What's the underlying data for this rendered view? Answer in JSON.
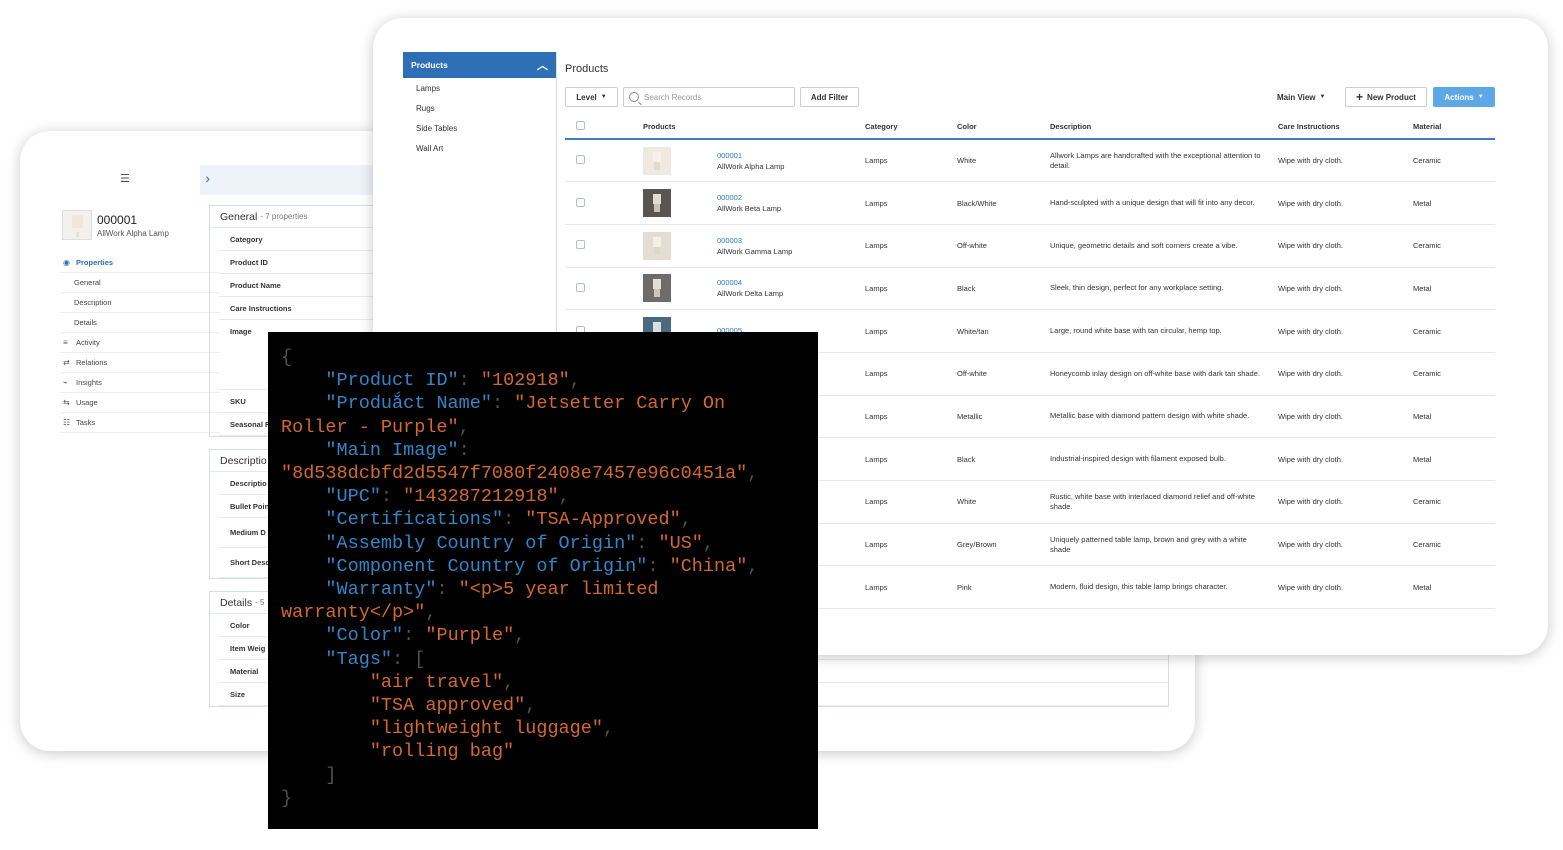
{
  "detail_window": {
    "product_id": "000001",
    "product_name": "AllWork Alpha Lamp",
    "nav": [
      {
        "label": "Properties",
        "icon": "properties-icon",
        "active": true
      },
      {
        "label": "General",
        "sub": true
      },
      {
        "label": "Description",
        "sub": true
      },
      {
        "label": "Details",
        "sub": true
      },
      {
        "label": "Activity",
        "icon": "activity-icon"
      },
      {
        "label": "Relations",
        "icon": "relations-icon"
      },
      {
        "label": "Insights",
        "icon": "insights-icon"
      },
      {
        "label": "Usage",
        "icon": "usage-icon"
      },
      {
        "label": "Tasks",
        "icon": "tasks-icon"
      }
    ],
    "sections": {
      "general": {
        "title": "General",
        "count": "- 7 properties",
        "fields": [
          "Category",
          "Product ID",
          "Product Name",
          "Care Instructions",
          "Image",
          "SKU",
          "Seasonal F"
        ]
      },
      "description": {
        "title": "Descriptio",
        "fields": [
          "Descriptio",
          "Bullet Poin",
          "Medium D",
          "Short Desc"
        ]
      },
      "details": {
        "title": "Details",
        "count": "- 5",
        "fields": [
          "Color",
          "Item Weig",
          "Material",
          "Size"
        ]
      }
    }
  },
  "products_window": {
    "sidebar": {
      "header": "Products",
      "items": [
        "Lamps",
        "Rugs",
        "Side Tables",
        "Wall Art"
      ]
    },
    "title": "Products",
    "toolbar": {
      "level_label": "Level",
      "search_placeholder": "Search Records",
      "add_filter_label": "Add Filter",
      "main_view_label": "Main View",
      "new_product_label": "New Product",
      "actions_label": "Actions"
    },
    "columns": [
      "Products",
      "Category",
      "Color",
      "Description",
      "Care Instructions",
      "Material"
    ],
    "rows": [
      {
        "id": "000001",
        "name": "AllWork Alpha Lamp",
        "category": "Lamps",
        "color": "White",
        "description": "Allwork Lamps are handcrafted with the exceptional attention to detail.",
        "care": "Wipe with dry cloth.",
        "material": "Ceramic",
        "thumb": "#efe9e1"
      },
      {
        "id": "000002",
        "name": "AllWork Beta Lamp",
        "category": "Lamps",
        "color": "Black/White",
        "description": "Hand-sculpted with a unique design that will fit into any decor.",
        "care": "Wipe with dry cloth.",
        "material": "Metal",
        "thumb": "#5a5550"
      },
      {
        "id": "000003",
        "name": "AllWork Gamma Lamp",
        "category": "Lamps",
        "color": "Off-white",
        "description": "Unique, geometric details and soft corners create a vibe.",
        "care": "Wipe with dry cloth.",
        "material": "Ceramic",
        "thumb": "#e4ddd3"
      },
      {
        "id": "000004",
        "name": "AllWork Delta Lamp",
        "category": "Lamps",
        "color": "Black",
        "description": "Sleek, thin design, perfect for any workplace setting.",
        "care": "Wipe with dry cloth.",
        "material": "Metal",
        "thumb": "#6e6b68"
      },
      {
        "id": "000005",
        "name": "",
        "category": "Lamps",
        "color": "White/tan",
        "description": "Large, round white base with tan circular, hemp top.",
        "care": "Wipe with dry cloth.",
        "material": "Ceramic",
        "thumb": "#4a6a80"
      },
      {
        "id": "",
        "name": "",
        "category": "Lamps",
        "color": "Off-white",
        "description": "Honeycomb inlay design on off-white base with dark tan shade.",
        "care": "Wipe with dry cloth.",
        "material": "Ceramic",
        "thumb": ""
      },
      {
        "id": "",
        "name": "",
        "category": "Lamps",
        "color": "Metallic",
        "description": "Metallic base with diamond pattern design with white shade.",
        "care": "Wipe with dry cloth.",
        "material": "Metal",
        "thumb": ""
      },
      {
        "id": "",
        "name": "",
        "category": "Lamps",
        "color": "Black",
        "description": "Industrial-inspired design with filament exposed bulb.",
        "care": "Wipe with dry cloth.",
        "material": "Metal",
        "thumb": ""
      },
      {
        "id": "",
        "name": "",
        "category": "Lamps",
        "color": "White",
        "description": "Rustic, white base with interlaced diamond relief and off-white shade.",
        "care": "Wipe with dry cloth.",
        "material": "Ceramic",
        "thumb": ""
      },
      {
        "id": "",
        "name": "",
        "category": "Lamps",
        "color": "Grey/Brown",
        "description": "Uniquely patterned table lamp, brown and grey with a white shade",
        "care": "Wipe with dry cloth.",
        "material": "Ceramic",
        "thumb": ""
      },
      {
        "id": "",
        "name": "",
        "category": "Lamps",
        "color": "Pink",
        "description": "Modern, fluid design, this table lamp brings character.",
        "care": "Wipe with dry cloth.",
        "material": "Metal",
        "thumb": ""
      }
    ]
  },
  "code_panel": {
    "open_brace": "{",
    "close_brace": "}",
    "entries": [
      {
        "key": "\"Product ID\"",
        "value": "\"102918\""
      },
      {
        "key": "\"Produắct Name\"",
        "value": "\"Jetsetter Carry On Roller - Purple\""
      },
      {
        "key": "\"Main Image\"",
        "value": "\"8d538dcbfd2d5547f7080f2408e7457e96c0451a\""
      },
      {
        "key": "\"UPC\"",
        "value": "\"143287212918\""
      },
      {
        "key": "\"Certifications\"",
        "value": "\"TSA-Approved\""
      },
      {
        "key": "\"Assembly Country of Origin\"",
        "value": "\"US\""
      },
      {
        "key": "\"Component Country of Origin\"",
        "value": "\"China\""
      },
      {
        "key": "\"Warranty\"",
        "value": "\"<p>5 year limited warranty</p>\""
      },
      {
        "key": "\"Color\"",
        "value": "\"Purple\""
      }
    ],
    "tags_key": "\"Tags\"",
    "tags": [
      "\"air travel\"",
      "\"TSA approved\"",
      "\"lightweight luggage\"",
      "\"rolling bag\""
    ]
  },
  "colors": {
    "accent": "#2f6fb6",
    "link": "#2a7bc6",
    "code_key": "#2f87c8",
    "code_value": "#d3692c"
  }
}
